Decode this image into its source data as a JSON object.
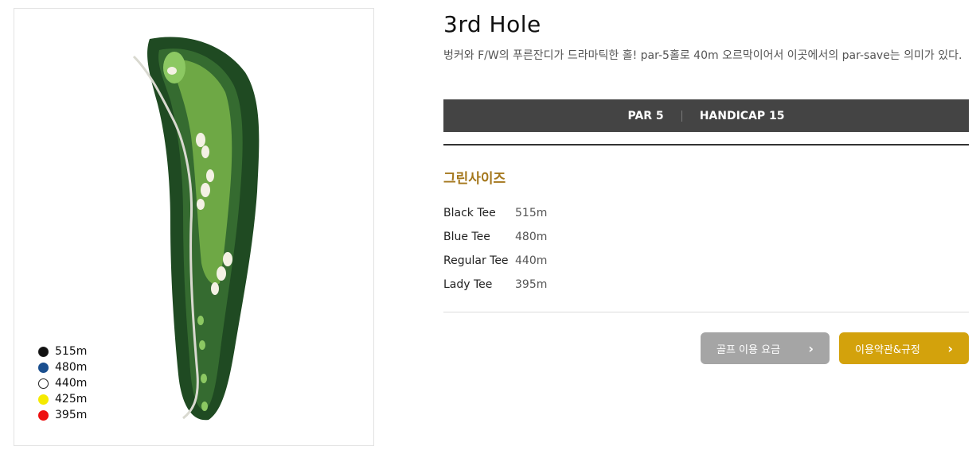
{
  "hole": {
    "title": "3rd Hole",
    "description": "벙커와 F/W의 푸른잔디가 드라마틱한 홀! par-5홀로 40m 오르막이어서 이곳에서의 par-save는 의미가 있다.",
    "par_label": "PAR 5",
    "handicap_label": "HANDICAP 15"
  },
  "green_size": {
    "title": "그린사이즈",
    "tees": [
      {
        "name": "Black Tee",
        "distance": "515m"
      },
      {
        "name": "Blue Tee",
        "distance": "480m"
      },
      {
        "name": "Regular Tee",
        "distance": "440m"
      },
      {
        "name": "Lady Tee",
        "distance": "395m"
      }
    ]
  },
  "legend": [
    {
      "distance": "515m",
      "color": "#111111"
    },
    {
      "distance": "480m",
      "color": "#1a4f8f"
    },
    {
      "distance": "440m",
      "color": "#ffffff"
    },
    {
      "distance": "425m",
      "color": "#f5ea00"
    },
    {
      "distance": "395m",
      "color": "#ee1111"
    }
  ],
  "buttons": {
    "fee_label": "골프 이용 요금",
    "terms_label": "이용약관&규정",
    "chevron_icon": "chevron-right-icon"
  }
}
